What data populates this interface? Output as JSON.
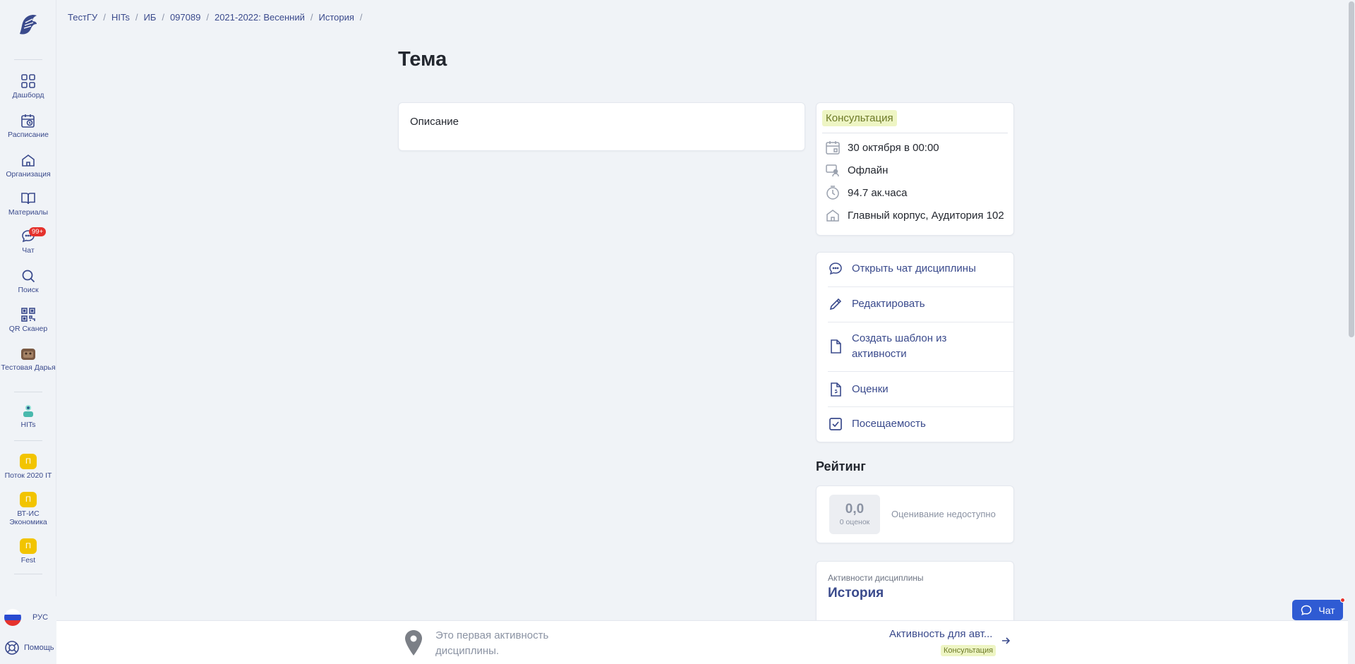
{
  "breadcrumbs": [
    "ТестГУ",
    "HITs",
    "ИБ",
    "097089",
    "2021-2022: Весенний",
    "История"
  ],
  "sidebar": {
    "items": [
      {
        "label": "Дашборд",
        "icon": "grid-icon"
      },
      {
        "label": "Расписание",
        "icon": "calendar-clock-icon"
      },
      {
        "label": "Организация",
        "icon": "building-icon"
      },
      {
        "label": "Материалы",
        "icon": "book-icon"
      },
      {
        "label": "Чат",
        "icon": "chat-icon",
        "badge": "99+"
      },
      {
        "label": "Поиск",
        "icon": "search-icon"
      },
      {
        "label": "QR Сканер",
        "icon": "qr-icon"
      },
      {
        "label": "Тестовая Дарья",
        "icon": "user-avatar-icon"
      },
      {
        "label": "HITs",
        "icon": "org-avatar-icon"
      },
      {
        "label": "Поток 2020 IT",
        "letter": "П"
      },
      {
        "label": "ВТ-ИС Экономика",
        "letter": "П"
      },
      {
        "label": "Fest",
        "letter": "П"
      }
    ],
    "language": "РУС",
    "help": "Помощь"
  },
  "page": {
    "title": "Тема"
  },
  "description": {
    "title": "Описание"
  },
  "info": {
    "type_tag": "Консультация",
    "date": "30 октября в 00:00",
    "format": "Офлайн",
    "duration": "94.7 ак.часа",
    "location": "Главный корпус, Аудитория 102"
  },
  "actions": {
    "open_chat": "Открыть чат дисциплины",
    "edit": "Редактировать",
    "create_template": "Создать шаблон из активности",
    "grades": "Оценки",
    "attendance": "Посещаемость"
  },
  "rating": {
    "heading": "Рейтинг",
    "score": "0,0",
    "count": "0 оценок",
    "status": "Оценивание недоступно"
  },
  "discipline_activities": {
    "caption": "Активности дисциплины",
    "title": "История"
  },
  "bottom_nav": {
    "first_text": "Это первая активность дисциплины.",
    "next_title": "Активность для авт...",
    "next_tag": "Консультация"
  },
  "chat_button": {
    "label": "Чат"
  },
  "colors": {
    "accent": "#3a4a8c",
    "primary": "#2f5bd3",
    "tag_bg": "#eef5c4",
    "badge": "#e5322d"
  }
}
